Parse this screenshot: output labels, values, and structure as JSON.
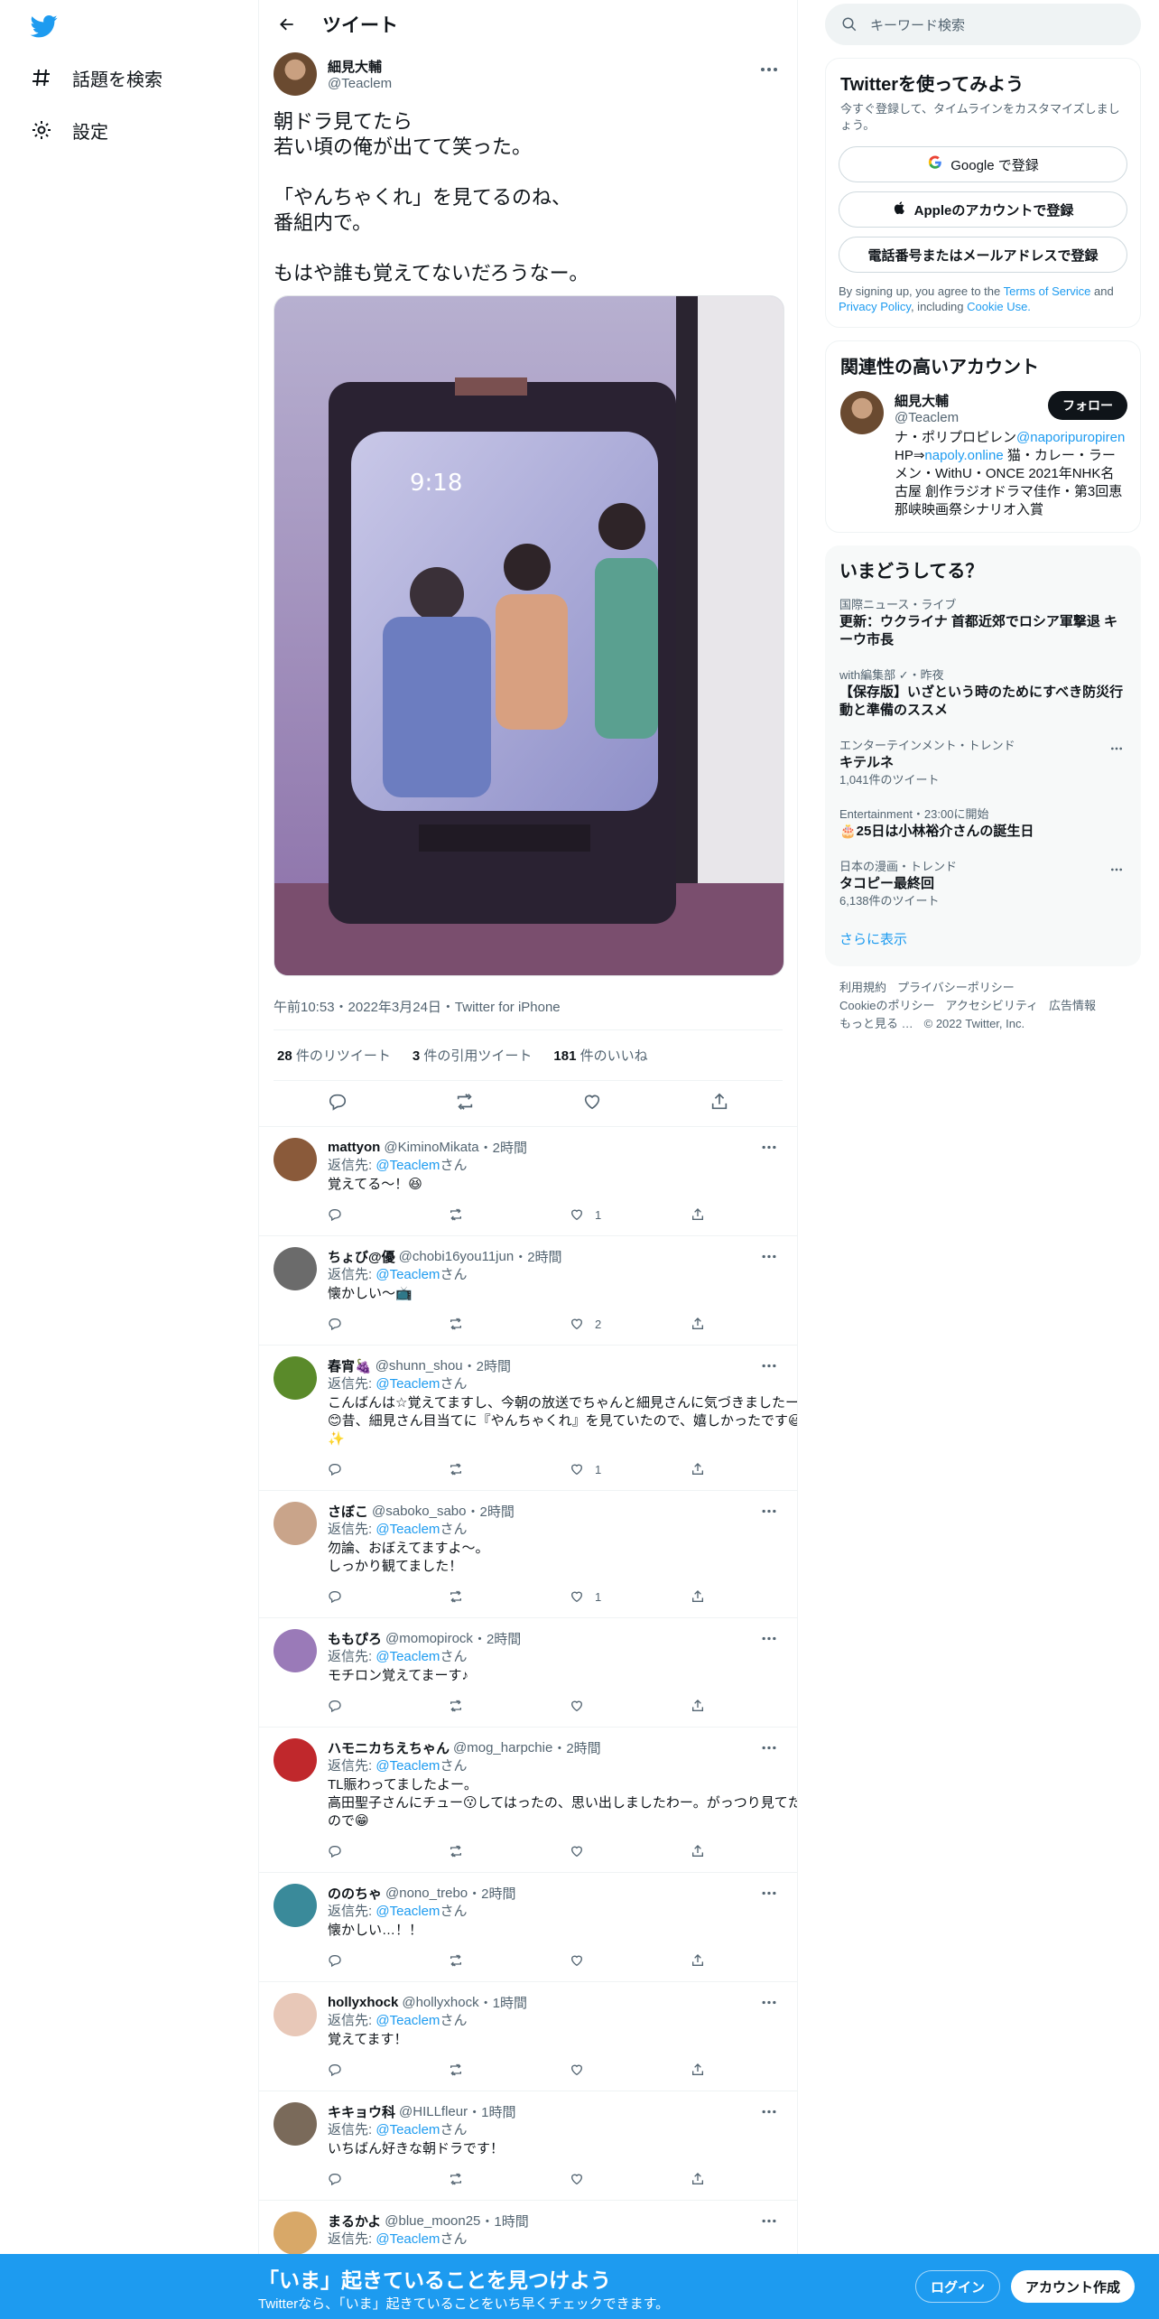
{
  "nav": {
    "explore_label": "話題を検索",
    "settings_label": "設定"
  },
  "header": {
    "title": "ツイート"
  },
  "tweet": {
    "name": "細見大輔",
    "handle": "@Teaclem",
    "text": "朝ドラ見てたら\n若い頃の俺が出てて笑った。\n\n「やんちゃくれ」を見てるのね、\n番組内で。\n\nもはや誰も覚えてないだろうなー。",
    "meta": "午前10:53・2022年3月24日・Twitter for iPhone",
    "retweets_count": "28",
    "retweets_label": "件のリツイート",
    "quotes_count": "3",
    "quotes_label": "件の引用ツイート",
    "likes_count": "181",
    "likes_label": "件のいいね",
    "photo_timestamp": "9:18"
  },
  "replies": [
    {
      "name": "mattyon",
      "handle": "@KiminoMikata",
      "time": "・2時間",
      "to_prefix": "返信先: ",
      "to_handle": "@Teaclem",
      "to_suffix": "さん",
      "text": "覚えてる〜！😆",
      "likes": "1",
      "avatar_color": "#8a5a3a"
    },
    {
      "name": "ちょび@優",
      "handle": "@chobi16you11jun",
      "time": "・2時間",
      "to_prefix": "返信先: ",
      "to_handle": "@Teaclem",
      "to_suffix": "さん",
      "text": "懐かしい〜📺",
      "likes": "2",
      "avatar_color": "#6b6b6b"
    },
    {
      "name": "春宵🍇",
      "handle": "@shunn_shou",
      "time": "・2時間",
      "to_prefix": "返信先: ",
      "to_handle": "@Teaclem",
      "to_suffix": "さん",
      "text": "こんばんは☆覚えてますし、今朝の放送でちゃんと細見さんに気づきましたー😊昔、細見さん目当てに『やんちゃくれ』を見ていたので、嬉しかったです😃✨",
      "likes": "1",
      "avatar_color": "#5a8a2a"
    },
    {
      "name": "さぼこ",
      "handle": "@saboko_sabo",
      "time": "・2時間",
      "to_prefix": "返信先: ",
      "to_handle": "@Teaclem",
      "to_suffix": "さん",
      "text": "勿論、おぼえてますよ～。\nしっかり観てました！",
      "likes": "1",
      "avatar_color": "#c9a48a"
    },
    {
      "name": "ももぴろ",
      "handle": "@momopirock",
      "time": "・2時間",
      "to_prefix": "返信先: ",
      "to_handle": "@Teaclem",
      "to_suffix": "さん",
      "text": "モチロン覚えてまーす♪",
      "likes": "",
      "avatar_color": "#9a7ab8"
    },
    {
      "name": "ハモニカちえちゃん",
      "handle": "@mog_harpchie",
      "time": "・2時間",
      "to_prefix": "返信先: ",
      "to_handle": "@Teaclem",
      "to_suffix": "さん",
      "text": "TL賑わってましたよー。\n高田聖子さんにチュー😗してはったの、思い出しましたわー。がっつり見てたので😁",
      "likes": "",
      "avatar_color": "#c0282c"
    },
    {
      "name": "ののちゃ",
      "handle": "@nono_trebo",
      "time": "・2時間",
      "to_prefix": "返信先: ",
      "to_handle": "@Teaclem",
      "to_suffix": "さん",
      "text": "懐かしい…！！",
      "likes": "",
      "avatar_color": "#3a8a9a"
    },
    {
      "name": "hollyxhock",
      "handle": "@hollyxhock",
      "time": "・1時間",
      "to_prefix": "返信先: ",
      "to_handle": "@Teaclem",
      "to_suffix": "さん",
      "text": "覚えてます！",
      "likes": "",
      "avatar_color": "#e8c8b8"
    },
    {
      "name": "キキョウ科",
      "handle": "@HILLfleur",
      "time": "・1時間",
      "to_prefix": "返信先: ",
      "to_handle": "@Teaclem",
      "to_suffix": "さん",
      "text": "いちばん好きな朝ドラです！",
      "likes": "",
      "avatar_color": "#7a6a5a"
    },
    {
      "name": "まるかよ",
      "handle": "@blue_moon25",
      "time": "・1時間",
      "to_prefix": "返信先: ",
      "to_handle": "@Teaclem",
      "to_suffix": "さん",
      "text": "",
      "likes": "",
      "avatar_color": "#d8a868"
    }
  ],
  "search": {
    "placeholder": "キーワード検索"
  },
  "signup": {
    "title": "Twitterを使ってみよう",
    "subtitle": "今すぐ登録して、タイムラインをカスタマイズしましょう。",
    "google_label": "Google で登録",
    "apple_label": "Appleのアカウントで登録",
    "phone_label": "電話番号またはメールアドレスで登録",
    "terms_prefix": "By signing up, you agree to the ",
    "terms_link": "Terms of Service",
    "terms_and": " and ",
    "privacy_link": "Privacy Policy",
    "terms_including": ", including ",
    "cookie_link": "Cookie Use."
  },
  "related": {
    "title": "関連性の高いアカウント",
    "name": "細見大輔",
    "handle": "@Teaclem",
    "follow_label": "フォロー",
    "bio_1": "ナ・ポリプロピレン",
    "bio_link_1": "@naporipuropiren",
    "bio_2": " HP⇒",
    "bio_link_2": "napoly.online",
    "bio_3": " 猫・カレー・ラーメン・WithU・ONCE 2021年NHK名古屋 創作ラジオドラマ佳作・第3回恵那峡映画祭シナリオ入賞"
  },
  "trends": {
    "title": "いまどうしてる？",
    "items": [
      {
        "meta": "国際ニュース・ライブ",
        "title": "更新：ウクライナ 首都近郊でロシア軍撃退 キーウ市長",
        "count": ""
      },
      {
        "meta": "with編集部 ✓・昨夜",
        "title": "【保存版】いざという時のためにすべき防災行動と準備のススメ",
        "count": ""
      },
      {
        "meta": "エンターテインメント・トレンド",
        "title": "キテルネ",
        "count": "1,041件のツイート"
      },
      {
        "meta": "Entertainment・23:00に開始",
        "title": "🎂25日は小林裕介さんの誕生日",
        "count": ""
      },
      {
        "meta": "日本の漫画・トレンド",
        "title": "タコピー最終回",
        "count": "6,138件のツイート"
      }
    ],
    "show_more": "さらに表示"
  },
  "footer": {
    "terms": "利用規約",
    "privacy": "プライバシーポリシー",
    "cookie": "Cookieのポリシー",
    "accessibility": "アクセシビリティ",
    "ads": "広告情報",
    "more": "もっと見る …",
    "copyright": "© 2022 Twitter, Inc."
  },
  "banner": {
    "title": "「いま」起きていることを見つけよう",
    "subtitle": "Twitterなら、「いま」起きていることをいち早くチェックできます。",
    "login_label": "ログイン",
    "signup_label": "アカウント作成"
  },
  "colors": {
    "accent": "#1d9bf0",
    "text": "#0f1419",
    "muted": "#536471"
  }
}
